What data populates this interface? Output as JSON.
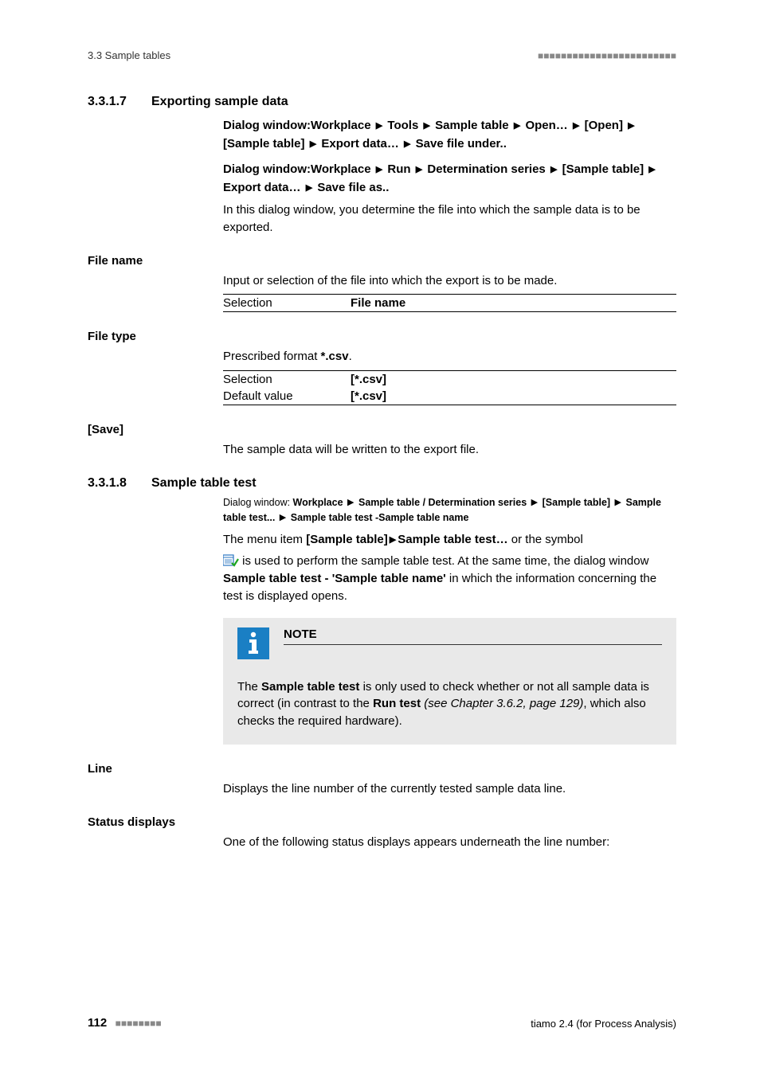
{
  "header": {
    "left": "3.3 Sample tables",
    "right_dashes": "■■■■■■■■■■■■■■■■■■■■■■■■"
  },
  "sec_3317": {
    "num": "3.3.1.7",
    "title": "Exporting sample data",
    "path1_prefix": "Dialog window:",
    "path1_parts": [
      "Workplace",
      "Tools",
      "Sample table",
      "Open…",
      "[Open]",
      "[Sample table]",
      "Export data…",
      "Save file under.."
    ],
    "path2_prefix": "Dialog window:",
    "path2_parts": [
      "Workplace",
      "Run",
      "Determination series",
      "[Sample table]",
      "Export data…",
      "Save file as.."
    ],
    "intro": "In this dialog window, you determine the file into which the sample data is to be exported."
  },
  "file_name": {
    "label": "File name",
    "desc": "Input or selection of the file into which the export is to be made.",
    "rows": [
      {
        "k": "Selection",
        "v": "File name"
      }
    ]
  },
  "file_type": {
    "label": "File type",
    "desc_pre": "Prescribed format ",
    "desc_bold": "*.csv",
    "desc_post": ".",
    "rows": [
      {
        "k": "Selection",
        "v": "[*.csv]"
      },
      {
        "k": "Default value",
        "v": "[*.csv]"
      }
    ]
  },
  "save": {
    "label": "[Save]",
    "desc": "The sample data will be written to the export file."
  },
  "sec_3318": {
    "num": "3.3.1.8",
    "title": "Sample table test",
    "small_path_prefix": "Dialog window: ",
    "small_path_parts": [
      "Workplace",
      "Sample table / Determination series",
      "[Sample table]",
      "Sample table test...",
      "Sample table test -Sample table name"
    ],
    "line1_pre": "The menu item ",
    "line1_bold1": "[Sample table]",
    "line1_tri": " ▶ ",
    "line1_bold2": "Sample table test…",
    "line1_post": " or the symbol",
    "line2_post_icon": " is used to perform the sample table test. At the same time, the dialog window ",
    "line2_bold": "Sample table test - 'Sample table name'",
    "line2_tail": " in which the information concerning the test is displayed opens."
  },
  "note": {
    "title": "NOTE",
    "body_pre": "The ",
    "body_bold1": "Sample table test",
    "body_mid1": " is only used to check whether or not all sample data is correct (in contrast to the ",
    "body_bold2": "Run test",
    "body_italic": " (see Chapter 3.6.2, page 129)",
    "body_tail": ", which also checks the required hardware)."
  },
  "line_field": {
    "label": "Line",
    "desc": "Displays the line number of the currently tested sample data line."
  },
  "status_displays": {
    "label": "Status displays",
    "desc": "One of the following status displays appears underneath the line number:"
  },
  "footer": {
    "page": "112",
    "dashes": "■■■■■■■■",
    "right": "tiamo 2.4 (for Process Analysis)"
  }
}
